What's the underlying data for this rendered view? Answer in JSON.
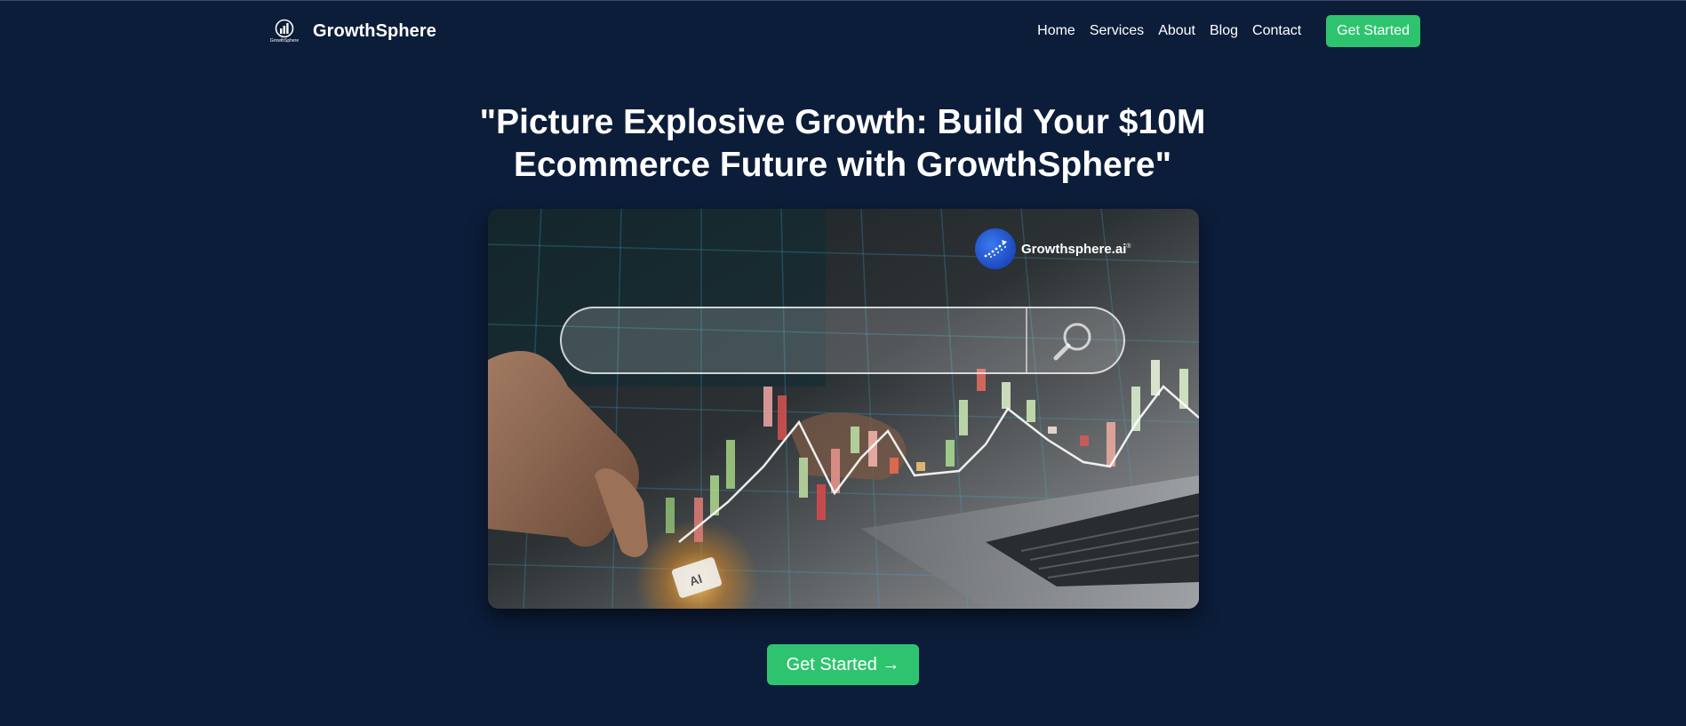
{
  "nav": {
    "brand_logo_text": "GrowthSphere",
    "brand_name": "GrowthSphere",
    "links": [
      "Home",
      "Services",
      "About",
      "Blog",
      "Contact"
    ],
    "cta_label": "Get Started"
  },
  "hero": {
    "headline": "\"Picture Explosive Growth: Build Your $10M Ecommerce Future with GrowthSphere\"",
    "image": {
      "brand_name": "Growthsphere.ai",
      "brand_mark": "®",
      "chip_label": "AI",
      "icons": [
        "magnifier-icon",
        "brand-badge-icon"
      ]
    },
    "cta_label": "Get Started →"
  },
  "colors": {
    "background": "#0c1d3a",
    "accent_green": "#2ec46f",
    "text": "#ffffff"
  }
}
